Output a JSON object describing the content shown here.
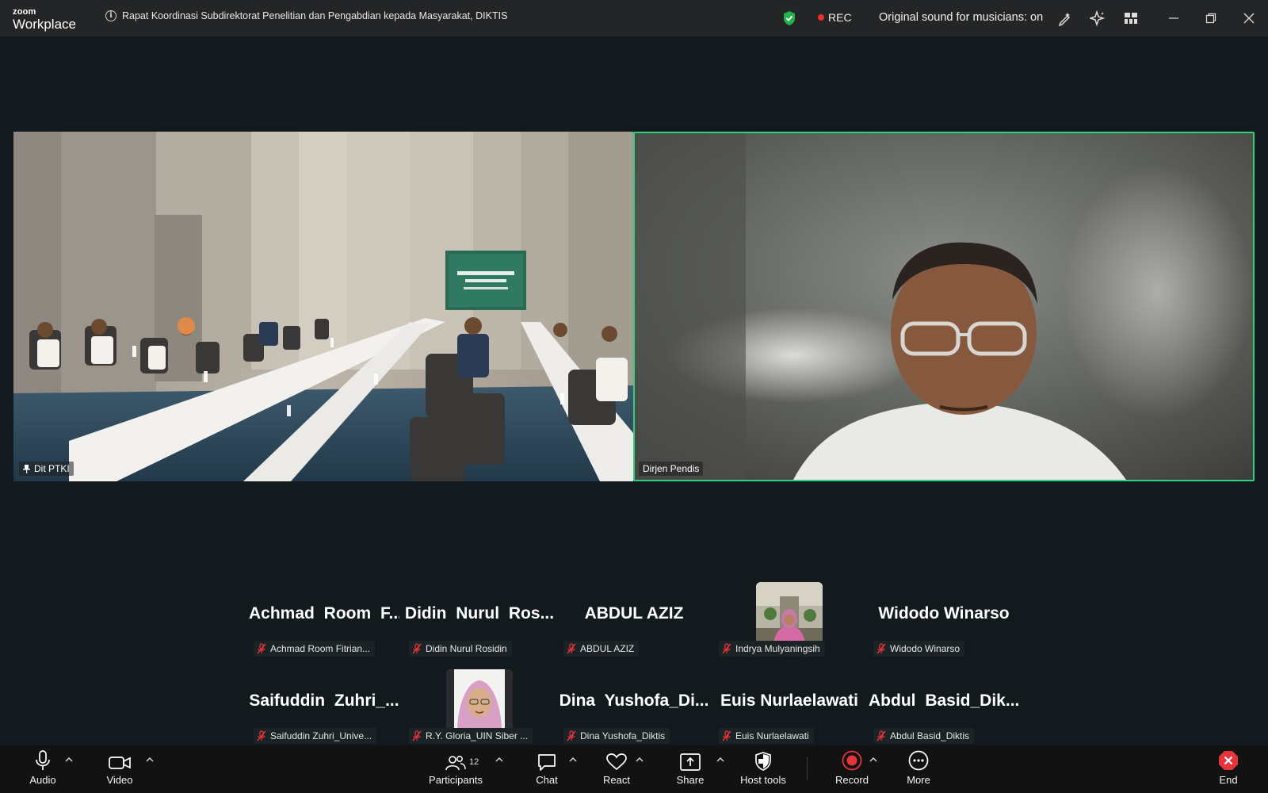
{
  "app": {
    "logo_line1": "zoom",
    "logo_line2": "Workplace",
    "meeting_title": "Rapat Koordinasi Subdirektorat Penelitian dan Pengabdian kepada Masyarakat, DIKTIS",
    "rec_label": "REC",
    "original_sound": "Original sound for musicians: on"
  },
  "icons": {
    "info": "info-icon",
    "encryption": "shield-check-icon",
    "whiteboard": "magic-pen-icon",
    "ai": "sparkle-icon",
    "view": "grid-view-icon"
  },
  "videos": [
    {
      "label": "Dit PTKI",
      "pinned": true
    },
    {
      "label": "Dirjen Pendis",
      "active_speaker": true
    }
  ],
  "participants": [
    {
      "display": "Achmad  Room  F...",
      "tag": "Achmad Room Fitrian...",
      "has_video": false
    },
    {
      "display": "Didin  Nurul  Ros...",
      "tag": "Didin Nurul Rosidin",
      "has_video": false
    },
    {
      "display": "ABDUL AZIZ",
      "tag": "ABDUL AZIZ",
      "has_video": false
    },
    {
      "display": "",
      "tag": "Indrya Mulyaningsih",
      "has_video": true
    },
    {
      "display": "Widodo Winarso",
      "tag": "Widodo Winarso",
      "has_video": false
    },
    {
      "display": "Saifuddin  Zuhri_...",
      "tag": "Saifuddin Zuhri_Unive...",
      "has_video": false
    },
    {
      "display": "",
      "tag": "R.Y. Gloria_UIN Siber ...",
      "has_video": true
    },
    {
      "display": "Dina  Yushofa_Di...",
      "tag": "Dina Yushofa_Diktis",
      "has_video": false
    },
    {
      "display": "Euis Nurlaelawati",
      "tag": "Euis Nurlaelawati",
      "has_video": false
    },
    {
      "display": "Abdul  Basid_Dik...",
      "tag": "Abdul Basid_Diktis",
      "has_video": false
    }
  ],
  "toolbar": {
    "audio": "Audio",
    "video": "Video",
    "participants": "Participants",
    "participants_count": "12",
    "chat": "Chat",
    "react": "React",
    "share": "Share",
    "host_tools": "Host tools",
    "record": "Record",
    "more": "More",
    "end": "End"
  },
  "colors": {
    "active_speaker_border": "#2fd27a",
    "rec_dot": "#e8312f",
    "end_red": "#e5343c",
    "background": "#121a1d"
  }
}
